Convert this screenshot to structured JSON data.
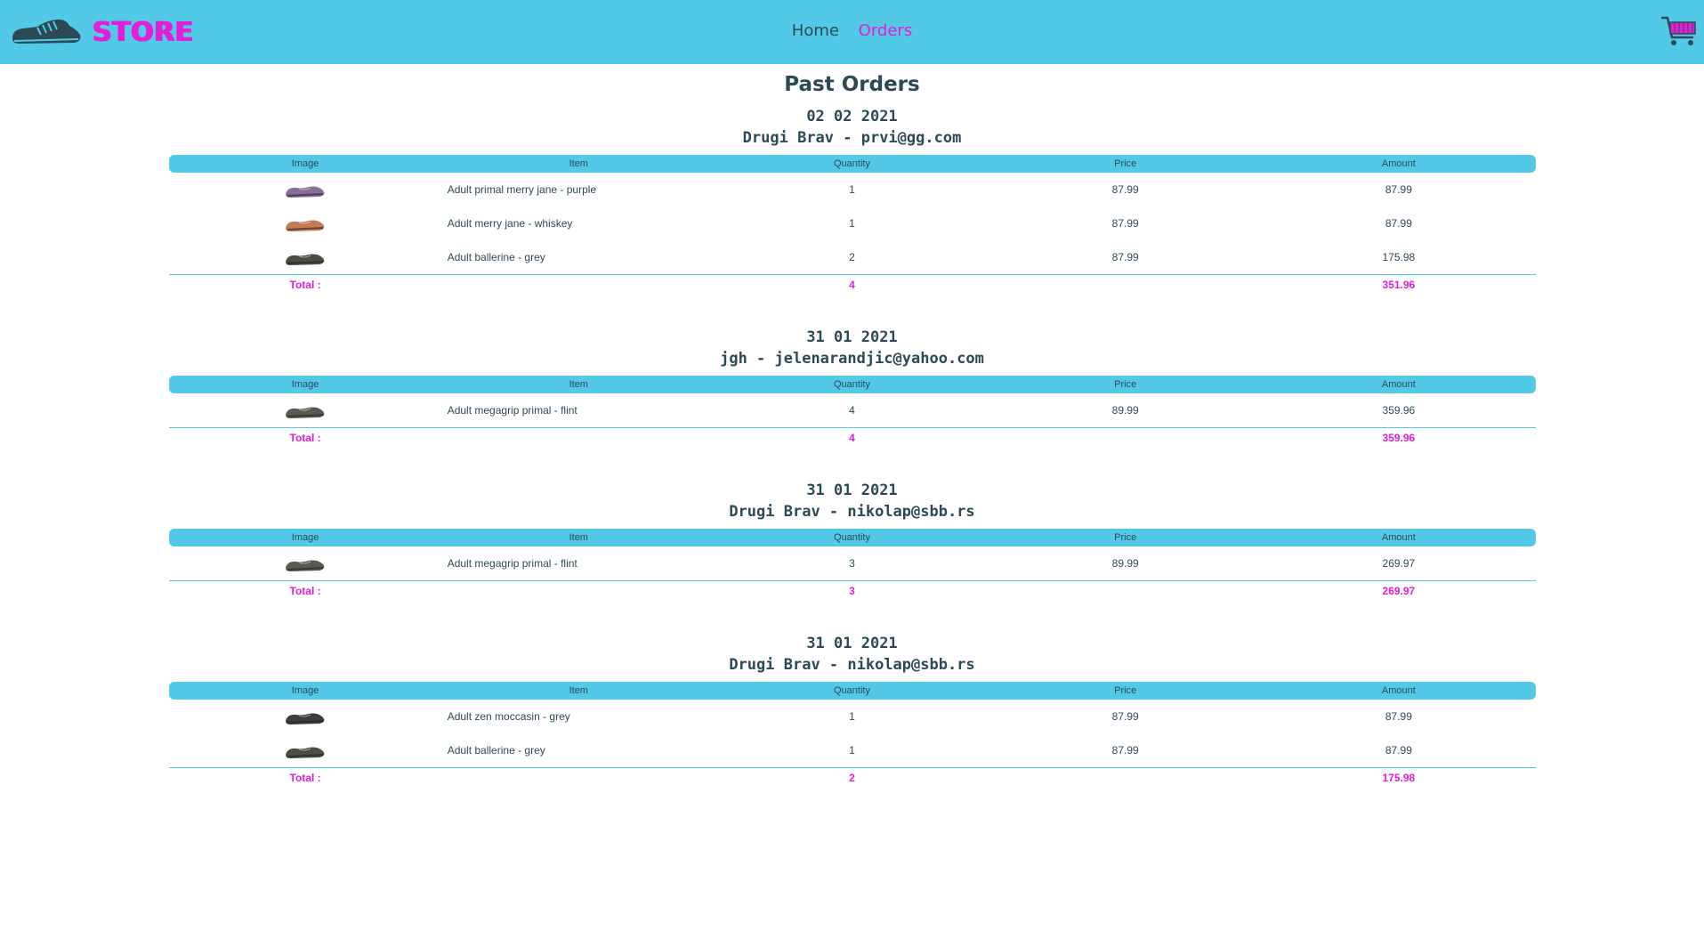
{
  "brand": {
    "name": "STORE",
    "logo_icon": "sneaker-icon",
    "accent_color": "#e21fd6",
    "nav_color": "#52c9e6"
  },
  "nav": {
    "home": "Home",
    "orders": "Orders",
    "cart_icon": "shopping-cart-icon"
  },
  "page": {
    "title": "Past Orders"
  },
  "table_headers": {
    "image": "Image",
    "item": "Item",
    "quantity": "Quantity",
    "price": "Price",
    "amount": "Amount"
  },
  "total_label": "Total :",
  "orders": [
    {
      "date": "02 02 2021",
      "customer": "Drugi Brav - prvi@gg.com",
      "items": [
        {
          "name": "Adult primal merry jane - purple",
          "quantity": "1",
          "price": "87.99",
          "amount": "87.99",
          "shoe_color": "#8a6e9a"
        },
        {
          "name": "Adult merry jane - whiskey",
          "quantity": "1",
          "price": "87.99",
          "amount": "87.99",
          "shoe_color": "#c47a52"
        },
        {
          "name": "Adult ballerine - grey",
          "quantity": "2",
          "price": "87.99",
          "amount": "175.98",
          "shoe_color": "#4d4d44"
        }
      ],
      "total_quantity": "4",
      "total_amount": "351.96"
    },
    {
      "date": "31 01 2021",
      "customer": "jgh - jelenarandjic@yahoo.com",
      "items": [
        {
          "name": "Adult megagrip primal - flint",
          "quantity": "4",
          "price": "89.99",
          "amount": "359.96",
          "shoe_color": "#5a5a52"
        }
      ],
      "total_quantity": "4",
      "total_amount": "359.96"
    },
    {
      "date": "31 01 2021",
      "customer": "Drugi Brav - nikolap@sbb.rs",
      "items": [
        {
          "name": "Adult megagrip primal - flint",
          "quantity": "3",
          "price": "89.99",
          "amount": "269.97",
          "shoe_color": "#5a5a52"
        }
      ],
      "total_quantity": "3",
      "total_amount": "269.97"
    },
    {
      "date": "31 01 2021",
      "customer": "Drugi Brav - nikolap@sbb.rs",
      "items": [
        {
          "name": "Adult zen moccasin - grey",
          "quantity": "1",
          "price": "87.99",
          "amount": "87.99",
          "shoe_color": "#3d3d3d"
        },
        {
          "name": "Adult ballerine - grey",
          "quantity": "1",
          "price": "87.99",
          "amount": "87.99",
          "shoe_color": "#4d4d44"
        }
      ],
      "total_quantity": "2",
      "total_amount": "175.98"
    }
  ]
}
